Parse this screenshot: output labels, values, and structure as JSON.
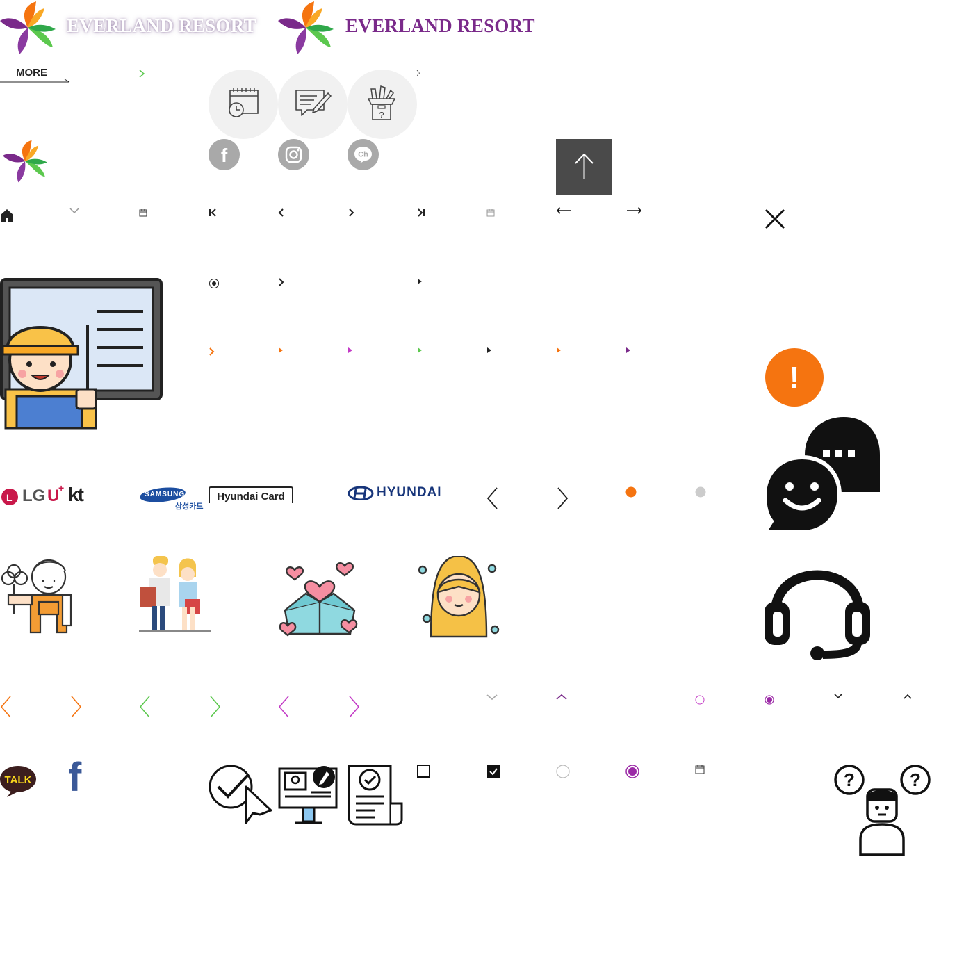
{
  "header": {
    "brand_name_white": "EVERLAND RESORT",
    "brand_name_purple": "EVERLAND RESORT",
    "more_label": "MORE"
  },
  "partners": {
    "lg": "LG",
    "uplus": "U",
    "kt": "kt",
    "samsung": "SAMSUNG",
    "samsung_sub": "삼성카드",
    "hyundaicard": "Hyundai Card",
    "hyundai": "HYUNDAI"
  },
  "sns": {
    "facebook_glyph": "f",
    "channel_glyph": "Ch",
    "kakao_talk": "TALK",
    "facebook_blue_glyph": "f"
  },
  "icons": {
    "help_glyph_left": "?",
    "help_glyph_right": "?",
    "box_question_glyph": "?",
    "alert_glyph": "!"
  },
  "colors": {
    "brand_purple": "#7a2a8a",
    "orange": "#f57410",
    "green": "#5cc84e",
    "magenta": "#c33ac6",
    "gray_btn": "#4a4a4a",
    "samsung_blue": "#1c4ea0",
    "hyundai_navy": "#17357a",
    "facebook_blue": "#3b5998",
    "kakao_yellow": "#f9d71c"
  }
}
